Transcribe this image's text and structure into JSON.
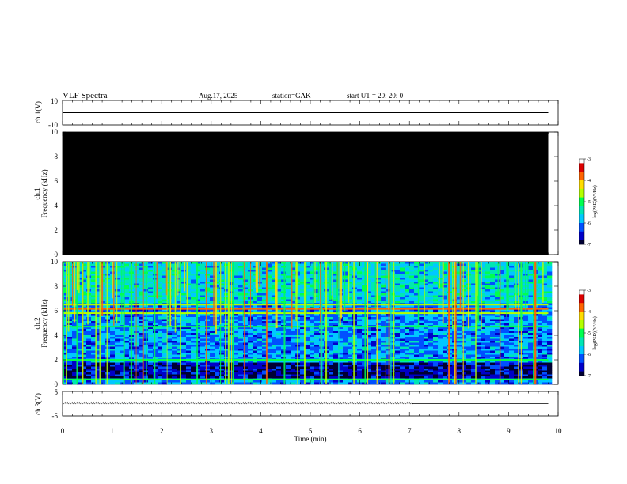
{
  "header": {
    "title": "VLF  Spectra",
    "date": "Aug.17, 2025",
    "station": "station=GAK",
    "start": "start  UT  =    20: 20: 0"
  },
  "colors": {
    "background": "#000000",
    "colormap": [
      "#000033",
      "#0000c8",
      "#0050ff",
      "#00c8ff",
      "#00e6b4",
      "#00ff50",
      "#b4ff00",
      "#ffdc00",
      "#ff6400",
      "#dc0000",
      "#ffffff"
    ]
  },
  "chart_data": [
    {
      "type": "line",
      "ylabel": "ch.1(V)",
      "ylim": [
        -10,
        10
      ],
      "yticks": [
        "10",
        "-10"
      ],
      "x": [
        0,
        9.8
      ],
      "y": [
        0,
        0
      ]
    },
    {
      "type": "heatmap",
      "ylabel_line1": "ch.1",
      "ylabel_line2": "Frequency  (kHz)",
      "ylim": [
        0,
        10
      ],
      "yticks": [
        "0",
        "2",
        "4",
        "6",
        "8",
        "10"
      ],
      "x_extent_min": 9.8,
      "note_values": "uniform minimum (below -7) across full panel",
      "colorbar": {
        "label": "log(PSD)(V²/Hz)",
        "range": [
          -7,
          -3
        ],
        "ticks": [
          "-7",
          "-6",
          "-5",
          "-4",
          "-3"
        ]
      }
    },
    {
      "type": "heatmap",
      "ylabel_line1": "ch.2",
      "ylabel_line2": "Frequency  (kHz)",
      "ylim": [
        0,
        10
      ],
      "yticks": [
        "0",
        "2",
        "4",
        "6",
        "8",
        "10"
      ],
      "x_extent_min": 9.8,
      "bands_khz": [
        {
          "f": 0.4,
          "level": -5.0
        },
        {
          "f": 2.0,
          "level": -5.2
        },
        {
          "f": 4.7,
          "level": -4.9
        },
        {
          "f": 5.8,
          "level": -4.8
        },
        {
          "f": 6.15,
          "level": -3.8
        },
        {
          "f": 6.5,
          "level": -4.6
        }
      ],
      "colorbar": {
        "label": "log(PSD)(V²/Hz)",
        "range": [
          -7,
          -3
        ],
        "ticks": [
          "-7",
          "-6",
          "-5",
          "-4",
          "-3"
        ]
      }
    },
    {
      "type": "line",
      "ylabel": "ch.3(V)",
      "ylim": [
        -5,
        5
      ],
      "yticks": [
        "5",
        "-5"
      ],
      "x": [
        0,
        7.05,
        7.05,
        9.8
      ],
      "y": [
        0.3,
        0.3,
        0.1,
        0.1
      ],
      "noisy_until_min": 7.05
    }
  ],
  "xaxis": {
    "label": "Time  (min)",
    "range": [
      0,
      10
    ],
    "ticks": [
      "0",
      "1",
      "2",
      "3",
      "4",
      "5",
      "6",
      "7",
      "8",
      "9",
      "10"
    ]
  }
}
